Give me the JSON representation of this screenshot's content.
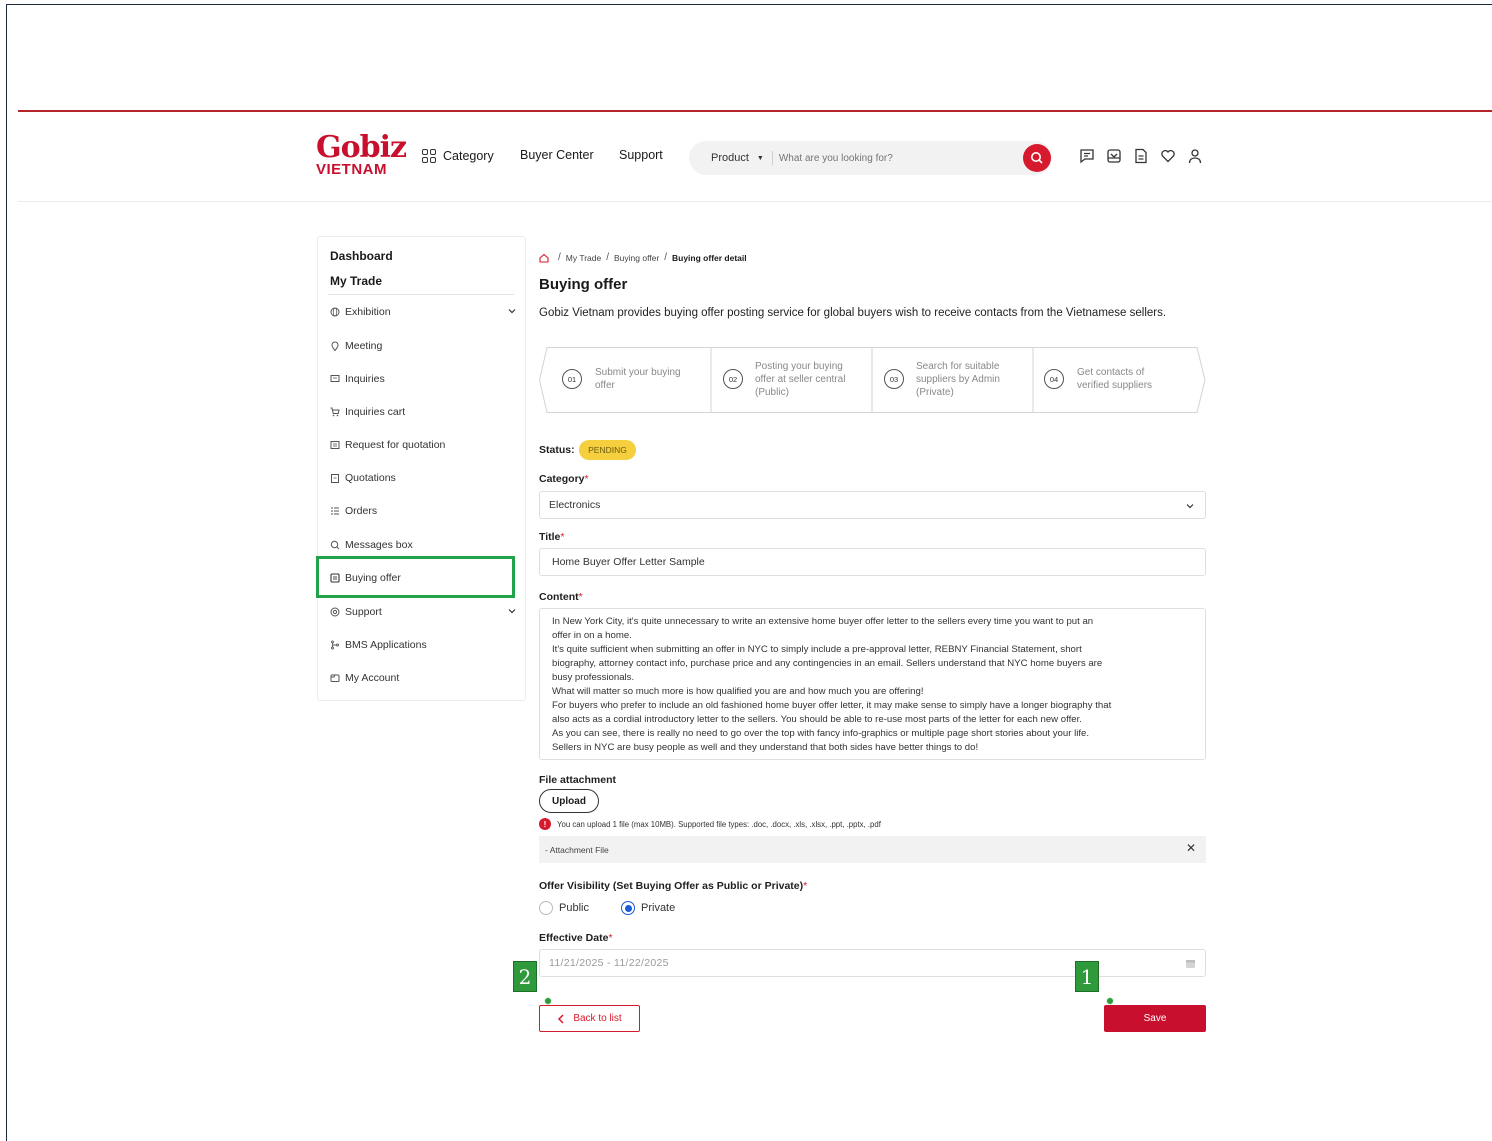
{
  "header": {
    "logo_main": "Gobiz",
    "logo_sub": "VIETNAM",
    "nav": {
      "category": "Category",
      "buyer_center": "Buyer Center",
      "support": "Support"
    },
    "search": {
      "scope": "Product",
      "placeholder": "What are you looking for?"
    },
    "icons": [
      "chat-icon",
      "inbox-icon",
      "document-icon",
      "heart-icon",
      "user-icon"
    ]
  },
  "sidebar": {
    "dashboard": "Dashboard",
    "section_title": "My Trade",
    "items": [
      {
        "label": "Exhibition",
        "icon": "globe-icon",
        "expandable": true
      },
      {
        "label": "Meeting",
        "icon": "pin-icon",
        "expandable": false
      },
      {
        "label": "Inquiries",
        "icon": "message-icon",
        "expandable": false
      },
      {
        "label": "Inquiries cart",
        "icon": "cart-icon",
        "expandable": false
      },
      {
        "label": "Request for quotation",
        "icon": "list-icon",
        "expandable": false
      },
      {
        "label": "Quotations",
        "icon": "clipboard-icon",
        "expandable": false
      },
      {
        "label": "Orders",
        "icon": "orders-icon",
        "expandable": false
      },
      {
        "label": "Messages box",
        "icon": "chat-bubble-icon",
        "expandable": false
      },
      {
        "label": "Buying offer",
        "icon": "offer-icon",
        "expandable": false,
        "active": true
      },
      {
        "label": "Support",
        "icon": "support-icon",
        "expandable": true
      },
      {
        "label": "BMS Applications",
        "icon": "branch-icon",
        "expandable": false
      },
      {
        "label": "My Account",
        "icon": "account-icon",
        "expandable": false
      }
    ]
  },
  "breadcrumb": {
    "items": [
      "My Trade",
      "Buying offer"
    ],
    "current": "Buying offer detail"
  },
  "page": {
    "title": "Buying offer",
    "description": "Gobiz Vietnam provides buying offer posting service for global buyers wish to receive contacts from the Vietnamese sellers."
  },
  "steps": [
    {
      "num": "01",
      "lines": [
        "Submit your buying",
        "offer"
      ]
    },
    {
      "num": "02",
      "lines": [
        "Posting your buying",
        "offer at seller central",
        "(Public)"
      ]
    },
    {
      "num": "03",
      "lines": [
        "Search for suitable",
        "suppliers by Admin",
        "(Private)"
      ]
    },
    {
      "num": "04",
      "lines": [
        "Get contacts of",
        "verified suppliers"
      ]
    }
  ],
  "form": {
    "status_label": "Status:",
    "status_value": "PENDING",
    "category_label": "Category",
    "category_value": "Electronics",
    "title_label": "Title",
    "title_value": "Home Buyer Offer Letter Sample",
    "content_label": "Content",
    "content_lines": [
      "In New York City, it's quite unnecessary to write an extensive home buyer offer letter to the sellers every time you want to put an",
      "offer in on a home.",
      "It's quite sufficient when submitting an offer in NYC to simply include a pre-approval letter, REBNY Financial Statement, short",
      "biography, attorney contact info, purchase price and any contingencies in an email. Sellers understand that NYC home buyers are",
      "busy professionals.",
      "What will matter so much more is how qualified you are and how much you are offering!",
      "For buyers who prefer to include an old fashioned home buyer offer letter, it may make sense to simply have a longer biography that",
      "also acts as a cordial introductory letter to the sellers. You should be able to re-use most parts of the letter for each new offer.",
      "As you can see, there is really no need to go over the top with fancy info-graphics or multiple page short stories about your life.",
      "Sellers in NYC are busy people as well and they understand that both sides have better things to do!"
    ],
    "attachment_label": "File attachment",
    "upload_label": "Upload",
    "upload_note": "You can upload 1 file (max 10MB). Supported file types: .doc, .docx, .xls, .xlsx, .ppt, .pptx, .pdf",
    "attachment_file": "- Attachment File",
    "visibility_label": "Offer Visibility (Set Buying Offer as Public or Private)",
    "visibility_options": [
      "Public",
      "Private"
    ],
    "visibility_selected": "Private",
    "date_label": "Effective Date",
    "date_value": "11/21/2025 - 11/22/2025",
    "required_mark": "*"
  },
  "actions": {
    "back_label": "Back to list",
    "save_label": "Save"
  },
  "markers": [
    "1",
    "2"
  ],
  "colors": {
    "brand": "#c8102e",
    "status_pending": "#f5cf3d",
    "highlight": "#22a34a",
    "radio_selected": "#1a5ad6"
  }
}
